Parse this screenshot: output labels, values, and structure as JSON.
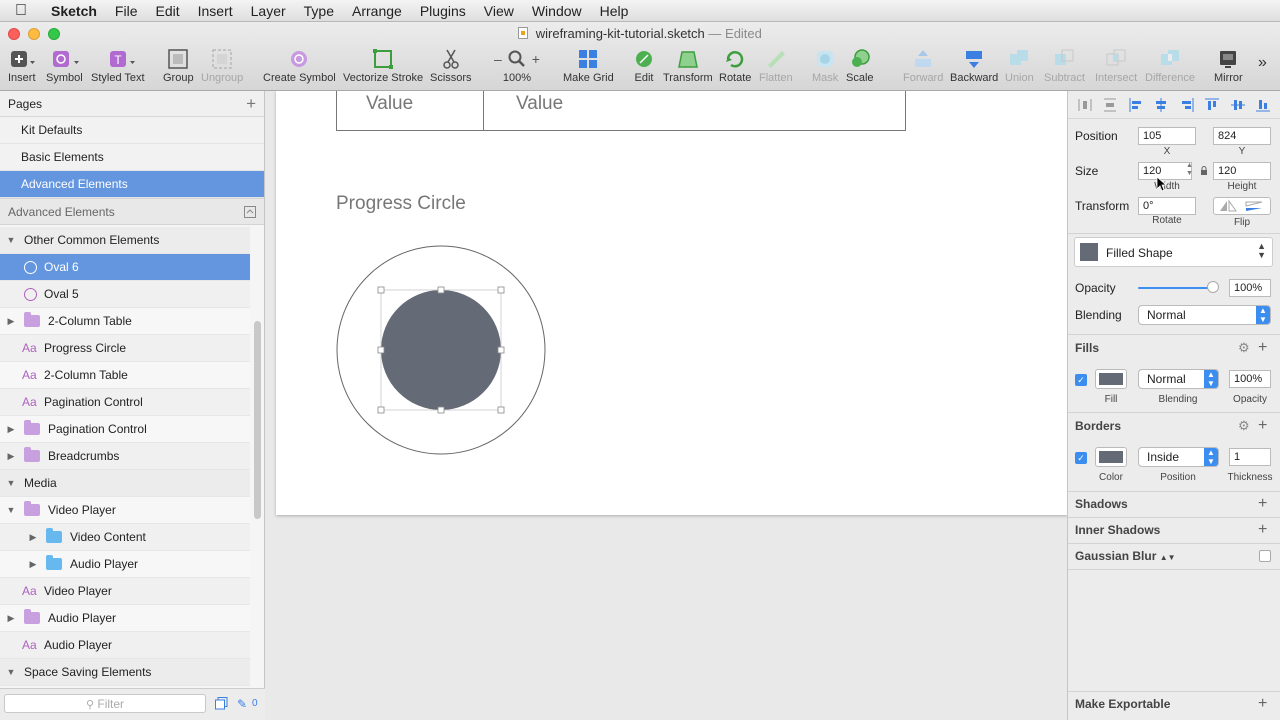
{
  "menubar": {
    "app": "Sketch",
    "items": [
      "File",
      "Edit",
      "Insert",
      "Layer",
      "Type",
      "Arrange",
      "Plugins",
      "View",
      "Window",
      "Help"
    ]
  },
  "window": {
    "title": "wireframing-kit-tutorial.sketch",
    "status": "— Edited"
  },
  "toolbar": {
    "insert": "Insert",
    "symbol": "Symbol",
    "styled_text": "Styled Text",
    "group": "Group",
    "ungroup": "Ungroup",
    "create_symbol": "Create Symbol",
    "vectorize_stroke": "Vectorize Stroke",
    "scissors": "Scissors",
    "zoom": "100%",
    "zoom_minus": "–",
    "zoom_plus": "+",
    "make_grid": "Make Grid",
    "edit": "Edit",
    "transform": "Transform",
    "rotate": "Rotate",
    "flatten": "Flatten",
    "mask": "Mask",
    "scale": "Scale",
    "forward": "Forward",
    "backward": "Backward",
    "union": "Union",
    "subtract": "Subtract",
    "intersect": "Intersect",
    "difference": "Difference",
    "mirror": "Mirror",
    "more": "»",
    "styled_text_glyph": "T"
  },
  "pages": {
    "title": "Pages",
    "add": "+",
    "items": [
      "Kit Defaults",
      "Basic Elements",
      "Advanced Elements"
    ],
    "section": "Advanced Elements"
  },
  "layers": [
    {
      "label": "Other Common Elements",
      "kind": "group-open"
    },
    {
      "label": "Oval 6",
      "kind": "oval",
      "selected": true
    },
    {
      "label": "Oval 5",
      "kind": "oval"
    },
    {
      "label": "2-Column Table",
      "kind": "folder"
    },
    {
      "label": "Progress Circle",
      "kind": "text"
    },
    {
      "label": "2-Column Table",
      "kind": "text"
    },
    {
      "label": "Pagination Control",
      "kind": "text"
    },
    {
      "label": "Pagination Control",
      "kind": "folder"
    },
    {
      "label": "Breadcrumbs",
      "kind": "folder"
    },
    {
      "label": "Media",
      "kind": "group-open"
    },
    {
      "label": "Video Player",
      "kind": "folder-open"
    },
    {
      "label": "Video Content",
      "kind": "subfolder"
    },
    {
      "label": "Audio Player",
      "kind": "subfolder"
    },
    {
      "label": "Video Player",
      "kind": "text"
    },
    {
      "label": "Audio Player",
      "kind": "folder"
    },
    {
      "label": "Audio Player",
      "kind": "text"
    },
    {
      "label": "Space Saving Elements",
      "kind": "group-open"
    }
  ],
  "filter": {
    "placeholder": "Filter",
    "count": "0"
  },
  "canvas": {
    "table_value_1": "Value",
    "table_value_2": "Value",
    "progress_title": "Progress Circle",
    "fill_color": "#656a77"
  },
  "inspector": {
    "position_label": "Position",
    "x": "105",
    "y": "824",
    "x_label": "X",
    "y_label": "Y",
    "size_label": "Size",
    "width": "120",
    "height": "120",
    "width_label": "Width",
    "height_label": "Height",
    "transform_label": "Transform",
    "rotate": "0°",
    "rotate_label": "Rotate",
    "flip_label": "Flip",
    "style": "Filled Shape",
    "opacity_label": "Opacity",
    "opacity": "100%",
    "opacity_fraction": 1.0,
    "blending_label": "Blending",
    "blending": "Normal",
    "fills_title": "Fills",
    "fill_blending": "Normal",
    "fill_opacity": "100%",
    "fill_label": "Fill",
    "fill_blending_label": "Blending",
    "fill_opacity_label": "Opacity",
    "borders_title": "Borders",
    "border_position": "Inside",
    "border_thickness": "1",
    "color_label": "Color",
    "position_sub": "Position",
    "thickness_label": "Thickness",
    "shadows": "Shadows",
    "inner_shadows": "Inner Shadows",
    "gaussian_blur": "Gaussian Blur",
    "make_exportable": "Make Exportable"
  }
}
